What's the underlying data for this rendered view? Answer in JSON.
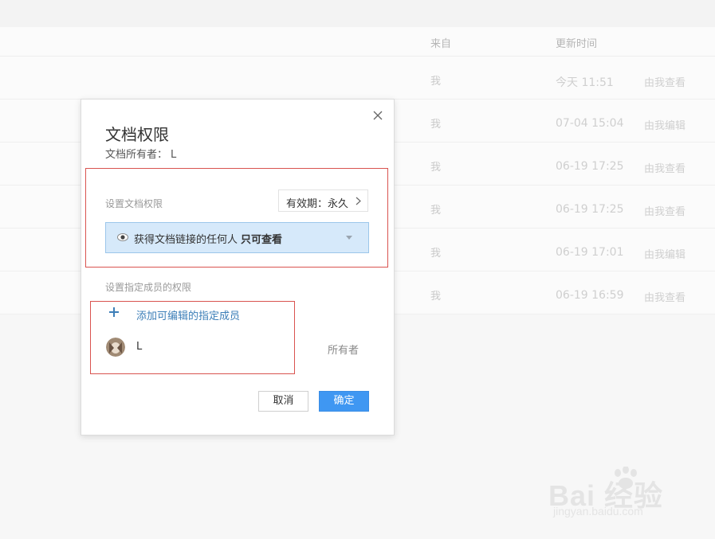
{
  "table": {
    "headers": {
      "from": "来自",
      "updated": "更新时间"
    },
    "rows": [
      {
        "from": "我",
        "time": "今天 11:51",
        "perm": "由我查看"
      },
      {
        "from": "我",
        "time": "07-04 15:04",
        "perm": "由我编辑"
      },
      {
        "from": "我",
        "time": "06-19 17:25",
        "perm": "由我查看"
      },
      {
        "from": "我",
        "time": "06-19 17:25",
        "perm": "由我查看"
      },
      {
        "from": "我",
        "time": "06-19 17:01",
        "perm": "由我编辑"
      },
      {
        "from": "我",
        "time": "06-19 16:59",
        "perm": "由我查看"
      }
    ]
  },
  "dialog": {
    "title": "文档权限",
    "owner_label": "文档所有者：",
    "owner_name": "L",
    "doc_perm_label": "设置文档权限",
    "validity": "有效期：永久",
    "link_perm_text": "获得文档链接的任何人",
    "link_perm_bold": "只可查看",
    "member_perm_label": "设置指定成员的权限",
    "add_member": "添加可编辑的指定成员",
    "member": {
      "name": "L",
      "role": "所有者"
    },
    "cancel": "取消",
    "ok": "确定"
  },
  "watermark": {
    "main": "Bai  经验",
    "sub": "jingyan.baidu.com"
  },
  "colors": {
    "accent": "#3f97f2",
    "highlight_border": "#d9534f",
    "select_bg": "#d6e9fa",
    "link": "#3d7fb8"
  },
  "icons": {
    "close": "close-icon",
    "eye": "eye-icon",
    "chevron": "chevron-right-icon",
    "plus": "plus-icon",
    "caret": "caret-down-icon"
  }
}
